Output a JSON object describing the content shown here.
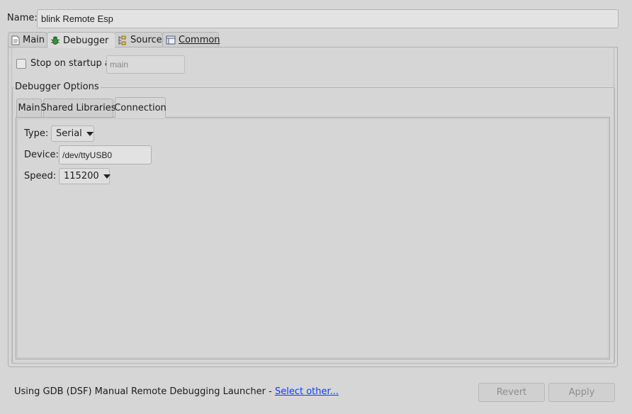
{
  "name": {
    "label": "Name:",
    "value": "blink Remote Esp"
  },
  "outer_tabs": [
    {
      "label": "Main",
      "icon": "document-icon"
    },
    {
      "label": "Debugger",
      "icon": "bug-icon",
      "active": true
    },
    {
      "label": "Source",
      "icon": "source-icon"
    },
    {
      "label": "Common",
      "icon": "window-icon"
    }
  ],
  "stop_on_startup": {
    "label": "Stop on startup at:",
    "checked": false,
    "value": "main"
  },
  "debugger_options": {
    "title": "Debugger Options",
    "tabs": [
      "Main",
      "Shared Libraries",
      "Connection"
    ],
    "active_tab": "Connection",
    "connection": {
      "type_label": "Type:",
      "type_value": "Serial",
      "device_label": "Device:",
      "device_value": "/dev/ttyUSB0",
      "speed_label": "Speed:",
      "speed_value": "115200"
    }
  },
  "footer": {
    "launcher_text": "Using GDB (DSF) Manual Remote Debugging Launcher - ",
    "select_other": "Select other...",
    "revert_label": "Revert",
    "apply_label": "Apply"
  },
  "colors": {
    "link": "#0a3cff",
    "background": "#d6d6d6"
  }
}
